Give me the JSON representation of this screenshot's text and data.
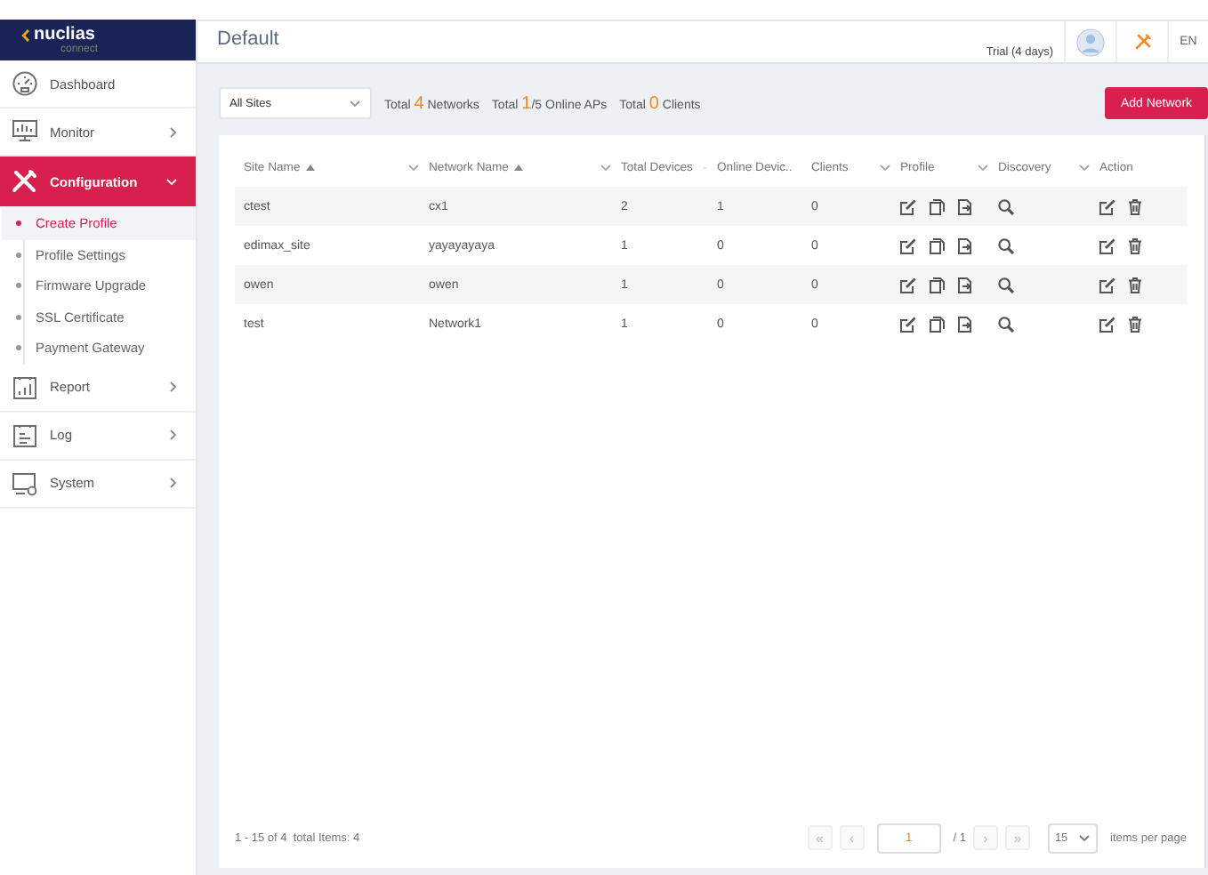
{
  "logo": {
    "brand": "nuclias",
    "sub": "connect"
  },
  "sidebar": {
    "items": [
      {
        "label": "Dashboard",
        "selected": false
      },
      {
        "label": "Monitor",
        "selected": false,
        "expanded": false
      },
      {
        "label": "Configuration",
        "selected": true,
        "expanded": true,
        "children": [
          {
            "label": "Create Profile",
            "selected": true
          },
          {
            "label": "Profile Settings",
            "selected": false
          },
          {
            "label": "Firmware Upgrade",
            "selected": false
          },
          {
            "label": "SSL Certificate",
            "selected": false
          },
          {
            "label": "Payment Gateway",
            "selected": false
          }
        ]
      },
      {
        "label": "Report",
        "selected": false,
        "expanded": false
      },
      {
        "label": "Log",
        "selected": false,
        "expanded": false
      },
      {
        "label": "System",
        "selected": false,
        "expanded": false
      }
    ]
  },
  "header": {
    "title": "Default",
    "trial": "Trial (4 days)",
    "language": "EN"
  },
  "toolbar": {
    "site_select": "All Sites",
    "stats": [
      {
        "prefix": "Total",
        "value": "4",
        "suffix": "Networks"
      },
      {
        "prefix": "Total",
        "value": "1",
        "suffix": "/5 Online APs"
      },
      {
        "prefix": "Total",
        "value": "0",
        "suffix": "Clients"
      }
    ],
    "add_button": "Add Network"
  },
  "table": {
    "columns": [
      {
        "label": "Site Name",
        "sortable": true
      },
      {
        "label": "Network Name",
        "sortable": true
      },
      {
        "label": "Total Devices",
        "sortable": false
      },
      {
        "label": "Online Devic..",
        "sortable": false
      },
      {
        "label": "Clients",
        "sortable": false
      },
      {
        "label": "Profile",
        "sortable": false
      },
      {
        "label": "Discovery",
        "sortable": false
      },
      {
        "label": "Action",
        "sortable": false
      }
    ],
    "rows": [
      {
        "site": "ctest",
        "network": "cx1",
        "total_devices": "2",
        "online_devices": "1",
        "clients": "0"
      },
      {
        "site": "edimax_site",
        "network": "yayayayaya",
        "total_devices": "1",
        "online_devices": "0",
        "clients": "0"
      },
      {
        "site": "owen",
        "network": "owen",
        "total_devices": "1",
        "online_devices": "0",
        "clients": "0"
      },
      {
        "site": "test",
        "network": "Network1",
        "total_devices": "1",
        "online_devices": "0",
        "clients": "0"
      }
    ]
  },
  "pager": {
    "summary": "1 - 15 of 4  total Items: 4",
    "first": "«",
    "prev": "‹",
    "page": "1",
    "of": "/ 1",
    "next": "›",
    "last": "»",
    "page_size": "15",
    "per_page": "items per page"
  }
}
